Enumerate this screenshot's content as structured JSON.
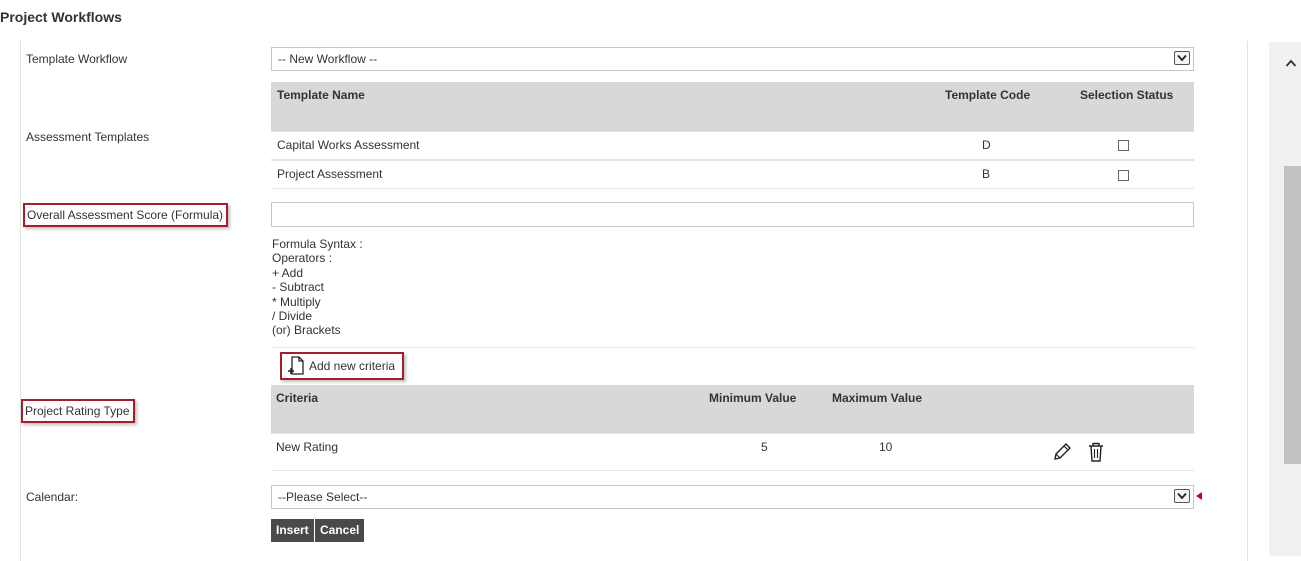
{
  "page": {
    "title": "Project Workflows"
  },
  "template_workflow": {
    "label": "Template Workflow",
    "selected": "-- New Workflow --"
  },
  "assessment_templates": {
    "label": "Assessment Templates",
    "columns": [
      "Template Name",
      "Template Code",
      "Selection Status"
    ],
    "rows": [
      {
        "name": "Capital Works Assessment",
        "code": "D",
        "selected": false
      },
      {
        "name": "Project Assessment",
        "code": "B",
        "selected": false
      }
    ]
  },
  "overall_score": {
    "label": "Overall Assessment Score (Formula)",
    "value": "",
    "syntax_lines": [
      "Formula Syntax :",
      "Operators :",
      "+ Add",
      "- Subtract",
      "* Multiply",
      "/ Divide",
      "(or) Brackets"
    ]
  },
  "project_rating": {
    "label": "Project Rating Type",
    "add_label": "Add new criteria",
    "columns": [
      "Criteria",
      "Minimum Value",
      "Maximum Value"
    ],
    "rows": [
      {
        "criteria": "New Rating",
        "min": "5",
        "max": "10"
      }
    ]
  },
  "calendar": {
    "label": "Calendar:",
    "selected": "--Please Select--"
  },
  "actions": {
    "insert_label": "Insert",
    "cancel_label": "Cancel"
  },
  "icons": {
    "edit": "pencil-icon",
    "delete": "trash-icon",
    "add": "new-document-icon",
    "dropdown": "chevron-down-icon",
    "scroll_up": "chevron-up-icon"
  },
  "colors": {
    "highlight": "#a0202a",
    "header_bg": "#d8d8d8",
    "button_bg": "#4a4a4a",
    "required": "#d0021b"
  }
}
